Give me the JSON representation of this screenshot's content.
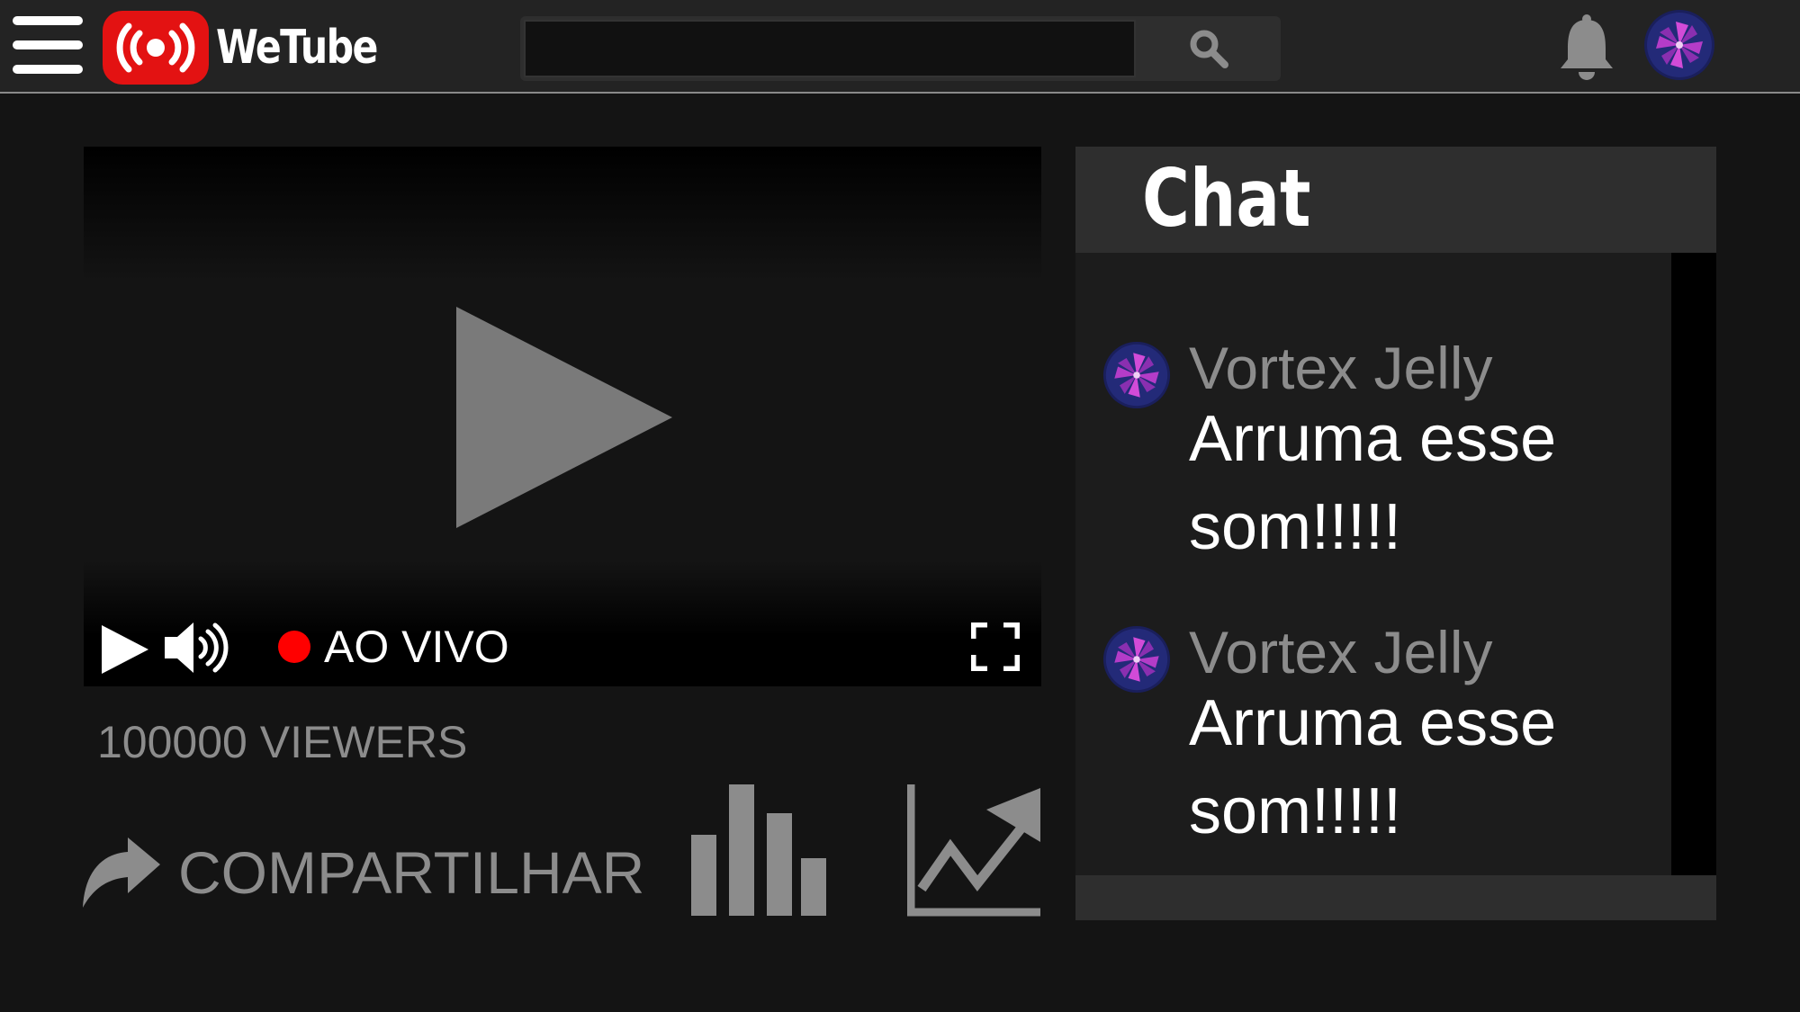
{
  "app": {
    "name": "WeTube"
  },
  "search": {
    "placeholder": "",
    "value": ""
  },
  "player": {
    "live_label": "AO VIVO",
    "progress": 1.0
  },
  "stats": {
    "viewers": "100000 VIEWERS"
  },
  "actions": {
    "share_label": "COMPARTILHAR"
  },
  "chat": {
    "title": "Chat",
    "messages": [
      {
        "user": "Vortex Jelly",
        "text": "Arruma esse som!!!!!"
      },
      {
        "user": "Vortex Jelly",
        "text": "Arruma esse som!!!!!"
      }
    ]
  },
  "colors": {
    "background": "#141414",
    "topbar": "#232323",
    "brand_red": "#e31212",
    "live_red": "#ff0000",
    "muted_text": "#8c8c8c",
    "chat_panel": "#1c1c1c",
    "chat_header": "#2e2e2e"
  },
  "icons": {
    "menu": "hamburger-menu-icon",
    "logo": "live-broadcast-icon",
    "search": "search-icon",
    "notifications": "bell-icon",
    "avatar": "pinwheel-avatar-icon",
    "play": "play-icon",
    "volume": "volume-icon",
    "fullscreen": "fullscreen-icon",
    "share": "share-arrow-icon",
    "stats": "bar-chart-icon",
    "trend": "trend-up-icon"
  }
}
